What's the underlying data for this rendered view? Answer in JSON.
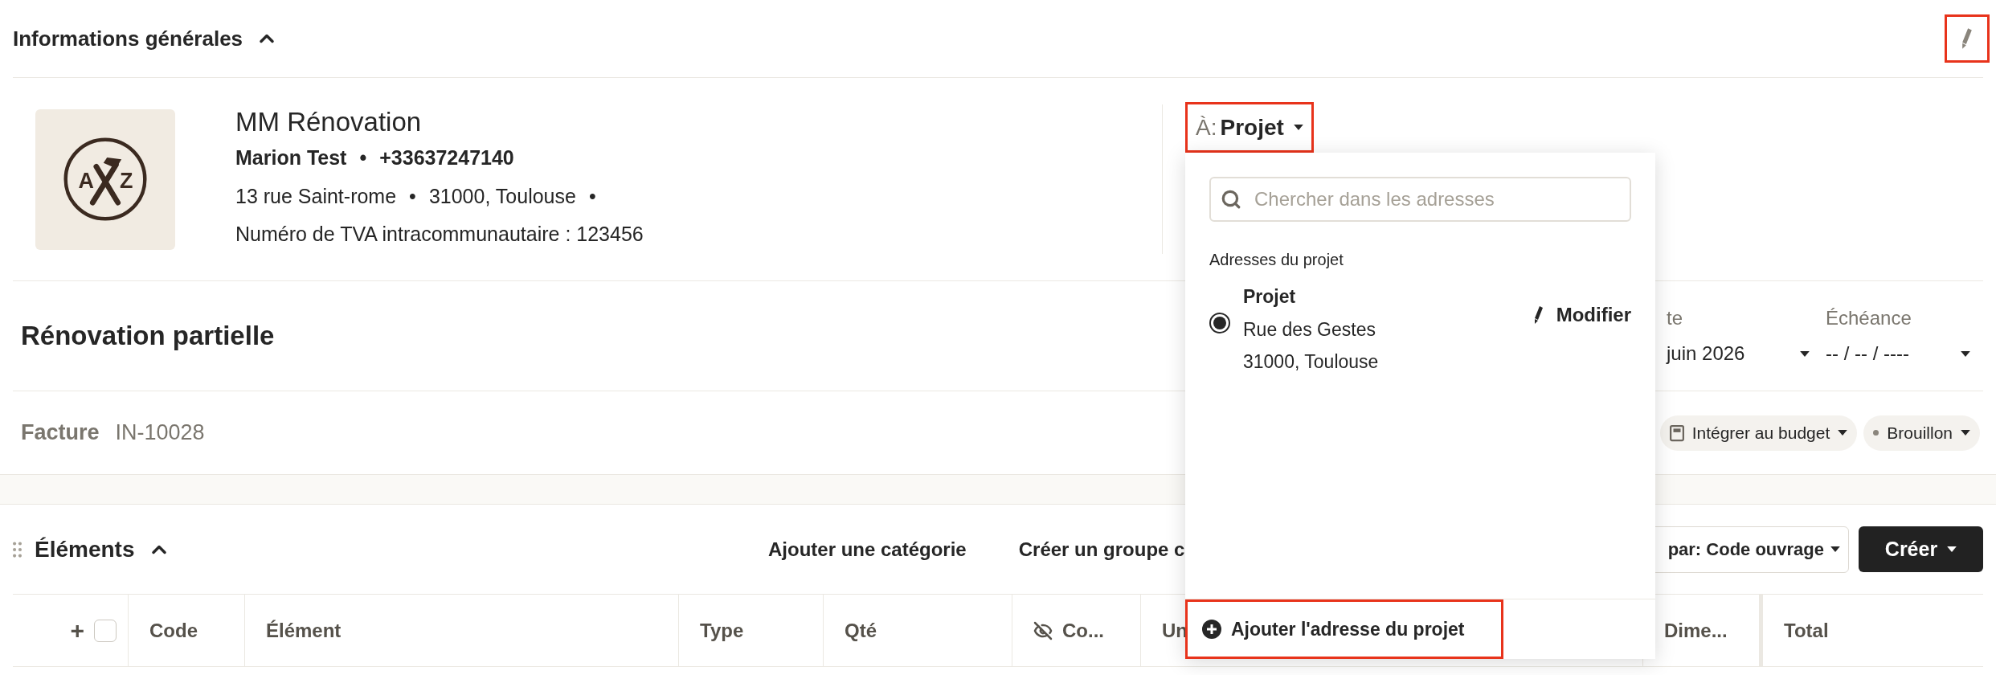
{
  "header": {
    "title": "Informations générales",
    "expanded": true,
    "edit_highlighted": true
  },
  "company": {
    "logo_letters": [
      "A",
      "Z"
    ],
    "separators": [
      "•",
      "•",
      "•"
    ],
    "name": "MM Rénovation",
    "contact_name": "Marion Test",
    "phone": "+33637247140",
    "street": "13 rue Saint-rome",
    "city": "31000, Toulouse",
    "vat": "Numéro de TVA intracommunautaire : 123456"
  },
  "recipient": {
    "prefix": "À:",
    "value": "Projet",
    "highlighted": true
  },
  "project_title": "Rénovation partielle",
  "dates": [
    {
      "label": "te",
      "value": "juin 2026"
    },
    {
      "label": "Échéance",
      "value": "-- / -- / ----"
    }
  ],
  "document": {
    "type": "Facture",
    "number": "IN-10028"
  },
  "chips": [
    {
      "kind": "budget",
      "label": "Intégrer au budget"
    },
    {
      "kind": "status",
      "label": "Brouillon"
    }
  ],
  "elements": {
    "title": "Éléments",
    "expanded": true,
    "actions": [
      "Ajouter une catégorie",
      "Créer un groupe c"
    ],
    "sort": "par: Code ouvrage",
    "create": "Créer"
  },
  "table": {
    "add": "+",
    "select_all_checked": false,
    "columns": [
      {
        "label": "Code",
        "hidden": false
      },
      {
        "label": "Élément",
        "hidden": false
      },
      {
        "label": "Type",
        "hidden": false
      },
      {
        "label": "Qté",
        "hidden": false
      },
      {
        "label": "Co...",
        "hidden": true
      },
      {
        "label": "Un",
        "hidden": false
      },
      {
        "label": "Dime...",
        "hidden": false
      },
      {
        "label": "Total",
        "hidden": false
      }
    ]
  },
  "dropdown": {
    "search_placeholder": "Chercher dans les adresses",
    "group_label": "Adresses du projet",
    "addresses": [
      {
        "name": "Projet",
        "lines": [
          "Rue des Gestes",
          "31000, Toulouse"
        ],
        "selected": true,
        "action": "Modifier"
      }
    ],
    "add_action": "Ajouter l'adresse du projet",
    "add_highlighted": true
  }
}
